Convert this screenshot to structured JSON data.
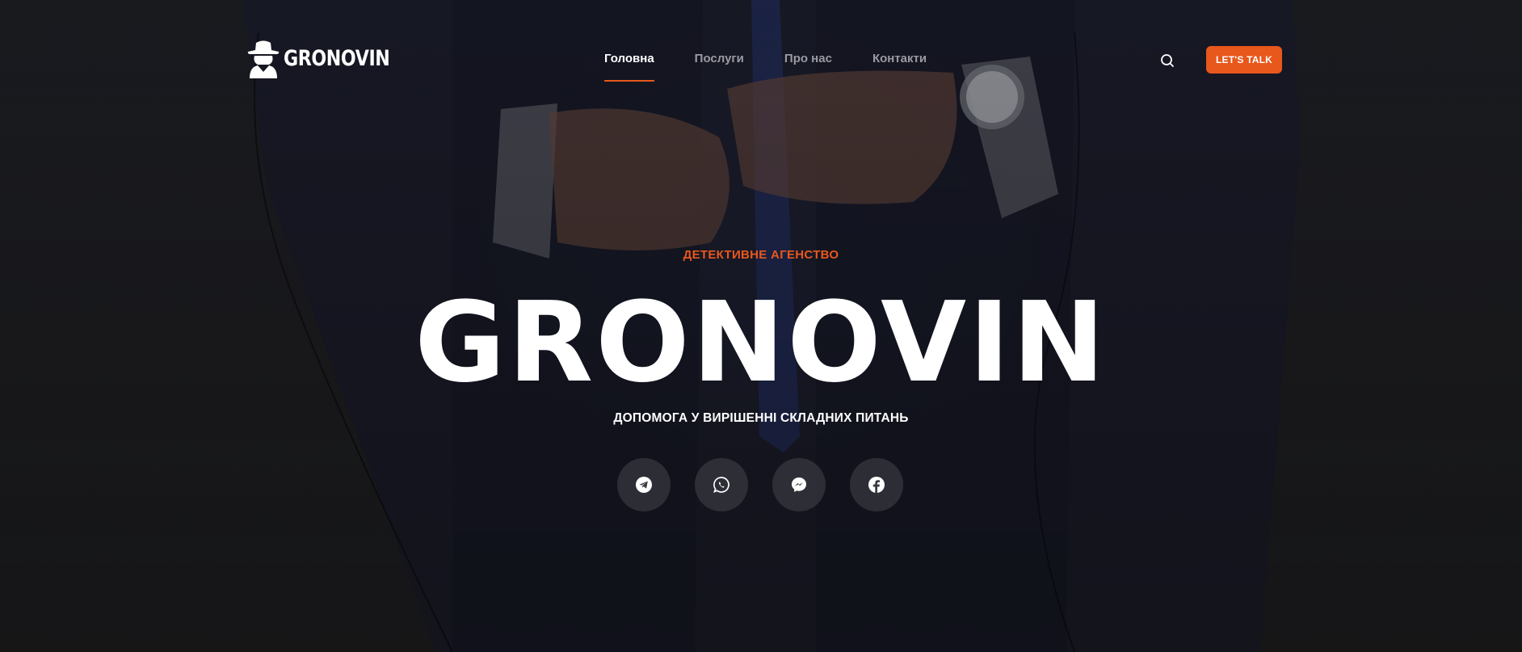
{
  "brand": {
    "logo_text": "GRONOVIN",
    "accent_color": "#e8571c"
  },
  "nav": {
    "items": [
      {
        "label": "Головна",
        "active": true
      },
      {
        "label": "Послуги",
        "active": false
      },
      {
        "label": "Про нас",
        "active": false
      },
      {
        "label": "Контакти",
        "active": false
      }
    ]
  },
  "header": {
    "search_icon": "search-icon",
    "cta_label": "LET'S TALK"
  },
  "hero": {
    "eyebrow": "ДЕТЕКТИВНЕ АГЕНСТВО",
    "title": "GRONOVIN",
    "subtitle": "ДОПОМОГА У ВИРІШЕННІ СКЛАДНИХ ПИТАНЬ"
  },
  "socials": [
    {
      "icon": "telegram-icon"
    },
    {
      "icon": "whatsapp-icon"
    },
    {
      "icon": "messenger-icon"
    },
    {
      "icon": "facebook-icon"
    }
  ]
}
